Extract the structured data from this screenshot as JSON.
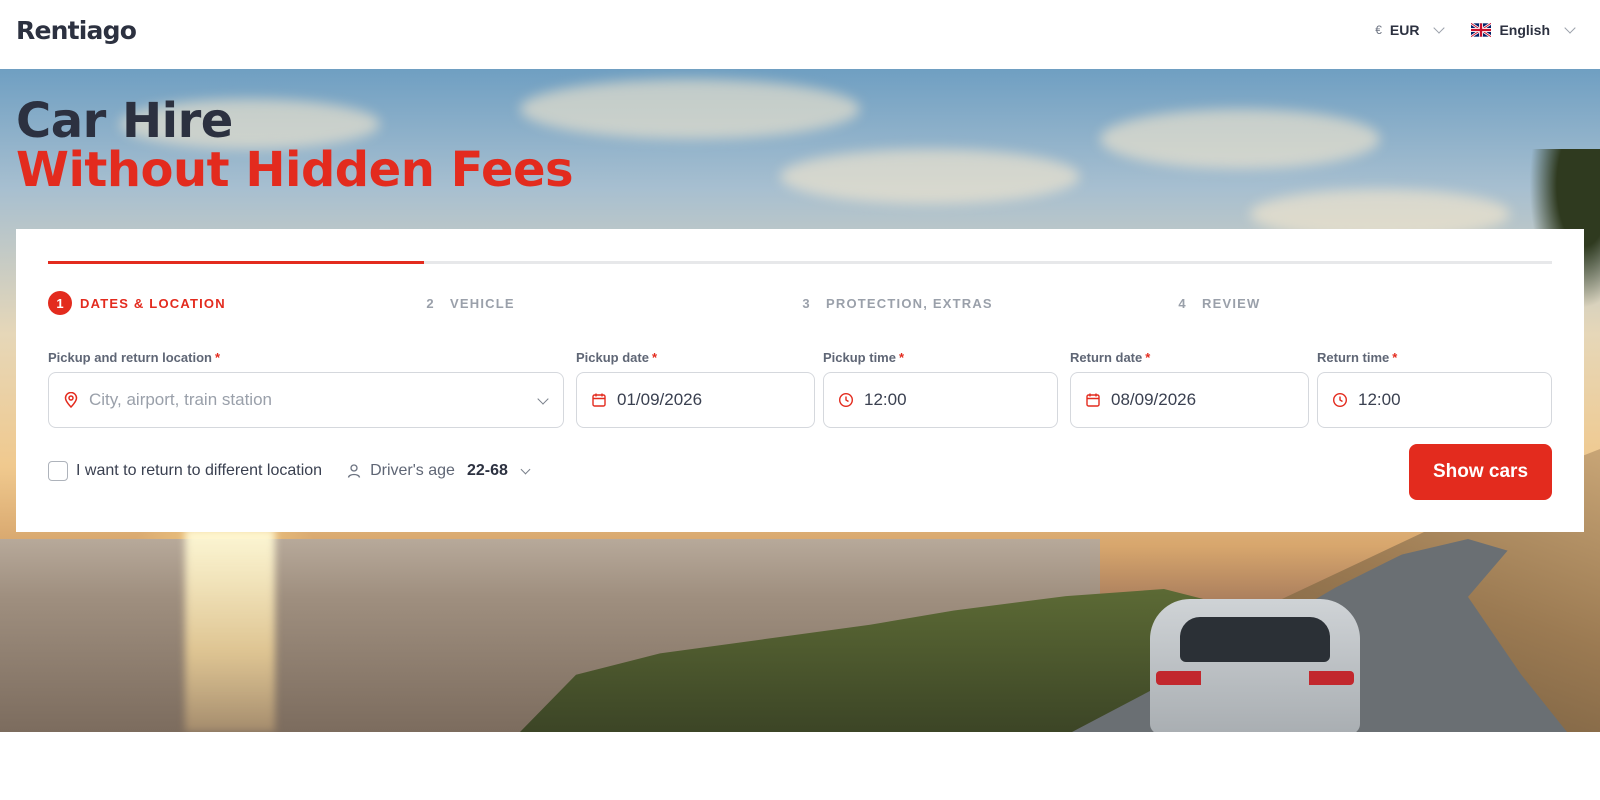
{
  "header": {
    "logo": "Rentiago",
    "currency": {
      "symbol": "€",
      "label": "EUR"
    },
    "language": {
      "label": "English",
      "flag": "uk-flag-icon"
    }
  },
  "hero": {
    "title_line1": "Car Hire",
    "title_line2": "Without Hidden Fees"
  },
  "booking": {
    "progress": 0.25,
    "steps": [
      {
        "num": "1",
        "label": "DATES & LOCATION",
        "active": true
      },
      {
        "num": "2",
        "label": "VEHICLE",
        "active": false
      },
      {
        "num": "3",
        "label": "PROTECTION, EXTRAS",
        "active": false
      },
      {
        "num": "4",
        "label": "REVIEW",
        "active": false
      }
    ],
    "fields": {
      "location": {
        "label": "Pickup and return location",
        "required": "*",
        "placeholder": "City, airport, train station",
        "icon": "location-pin-icon"
      },
      "pickup_date": {
        "label": "Pickup date",
        "required": "*",
        "value": "01/09/2026",
        "icon": "calendar-icon"
      },
      "pickup_time": {
        "label": "Pickup time",
        "required": "*",
        "value": "12:00",
        "icon": "clock-icon"
      },
      "return_date": {
        "label": "Return date",
        "required": "*",
        "value": "08/09/2026",
        "icon": "calendar-icon"
      },
      "return_time": {
        "label": "Return time",
        "required": "*",
        "value": "12:00",
        "icon": "clock-icon"
      }
    },
    "different_location_label": "I want to return to different location",
    "driver_age": {
      "label": "Driver's age",
      "value": "22-68",
      "icon": "user-icon"
    },
    "submit_label": "Show cars"
  },
  "colors": {
    "accent": "#e32b1e",
    "text_dark": "#2c3140",
    "muted": "#9aa0aa"
  }
}
